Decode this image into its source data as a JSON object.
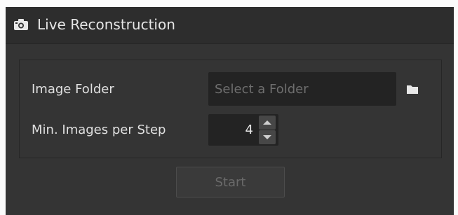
{
  "panel": {
    "title": "Live Reconstruction",
    "title_icon": "camera-icon"
  },
  "form": {
    "image_folder": {
      "label": "Image Folder",
      "value": "",
      "placeholder": "Select a Folder",
      "browse_icon": "folder-icon"
    },
    "min_images": {
      "label": "Min. Images per Step",
      "value": "4"
    }
  },
  "actions": {
    "start_label": "Start",
    "start_enabled": false
  },
  "colors": {
    "panel_bg": "#343434",
    "titlebar_bg": "#2d2d2d",
    "input_bg": "#232323"
  }
}
